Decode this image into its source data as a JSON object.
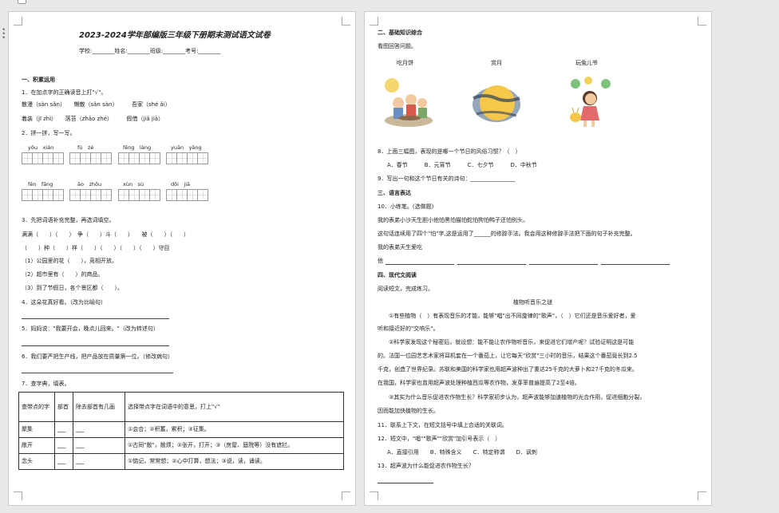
{
  "p1": {
    "title": "2023-2024学年部编版三年级下册期末测试语文试卷",
    "info": "学校:________姓名:________班级:________考号:________",
    "s1": "一、积累运用",
    "q1": "1．在加点字的正确读音上打\"√\"。",
    "q1a": "散漫（sàn sǎn）　　懒散（sǎn sàn）　　　吾家（shé ǎi）",
    "q1b": "着装（jī zhì）　　落苔（zhǎo zhé）　　　假借（jiǎ jià）",
    "q2": "2．拼一拼，写一写。",
    "py1": [
      "yōu　xián",
      "fù　zé",
      "fēng　làng",
      "yuān　yāng"
    ],
    "py2": [
      "fēn　fāng",
      "āo　zhōu",
      "xùn　sù",
      "dōi　jiā"
    ],
    "q3": "3．先把词语补充完整，再选词填空。",
    "q3a": "满满（　　）（　　）　争（　　）斗（　　）　　被（　　）（　　）",
    "q3b": "（　　）种（　　）样（　　）（　　）（　　）（　　）守目",
    "q3c": "（1）公园里的花（　　），竞相开放。",
    "q3d": "（2）超市里有（　　）的商品。",
    "q3e": "（3）到了节假日，各个景区都（　　）。",
    "q4": "4．这朵花真好看。（改为比喻句）",
    "q5": "5．妈妈说：\"我要开会，晚点儿回来。\"（改为转述句）",
    "q6": "6．我们要严把生产线，把产品放在质量第一位。（修改病句）",
    "q7": "7．查字典，填表。",
    "table": {
      "head": [
        "查带点的字",
        "部首",
        "除去部首有几画",
        "选择带点字在词语中的意思，打上\"√\""
      ],
      "rows": [
        [
          "聚集",
          "___",
          "___",
          "①会合；②积蓄，累积；③征集。"
        ],
        [
          "敞开",
          "___",
          "___",
          "①古同\"敞\"，敞烦；②张开，打开；③（房屋、庭院等）没有遮拦。"
        ],
        [
          "念头",
          "___",
          "___",
          "①惦记，常常想；②心中打算，想法；③说，读，诵读。"
        ]
      ]
    }
  },
  "p2": {
    "s2": "二、基础知识综合",
    "intro": "看图回答问题。",
    "cap": [
      "吃月饼",
      "赏月",
      "玩兔儿爷"
    ],
    "q8": "8．上面三幅图，表现的是哪一个节日的风俗习惯？（　）",
    "q8opts": "A．春节　　　B．元宵节　　　C．七夕节　　　D．中秋节",
    "q9": "9．写出一句和这个节日有关的诗句：________________",
    "s3": "三、语言表达",
    "q10": "10．小练笔。(选做题)",
    "q10a": "我的表弟小沙天生胆小他怕黑怕猫怕蛇怕狗怕鸭子还怕别头。",
    "q10b": "这句话连续用了四个\"怕\"字,这是运用了______的修辞手法。我会用这种修辞手法把下面的句子补充完整。",
    "q10c": "我的表弟天生爱吃",
    "q10d": "他",
    "s4": "四、现代文阅读",
    "intro2": "阅读短文，完成练习。",
    "ptitle": "植物听音乐之谜",
    "para1a": "①有些植物（　）有表现音乐的才能，能够\"唱\"出不同旋律的\"歌声\"，（　）它们还是音乐爱好者，爱",
    "para1b": "听和接近好的\"交响乐\"。",
    "para2a": "②科学家发现这个秘密后，就设想：能不能让农作物听音乐，来促进它们增产呢？试验证明这是可能",
    "para2b": "的。法国一位园艺艺术家将耳机套在一个番茄上，让它每天\"欣赏\"三小时的音乐，结果这个番茄竟长到2.5",
    "para2c": "千克，创造了世界纪录。苏联和美国的科学家也用超声波种出了重达25千克的大萝卜和27千克的冬瓜来。",
    "para2d": "在我国，科学家也曾用超声波处理种植西瓜等农作物，发芽率普遍提高了2至4倍。",
    "para3a": "③其实为什么音乐促进农作物生长？科学家初步认为，超声波能够加速植物的光合作用，促进细胞分裂，",
    "para3b": "因而能加快植物的生长。",
    "q11": "11．联系上下文，在短文括号中填上合适的关联词。",
    "q12": "12．短文中，\"唱\"\"歌声\"\"欣赏\"加引号表示（　）",
    "q12opts": "A．直接引用　　B．特殊含义　　C．特定称谓　　D．讽刺",
    "q13": "13．超声波为什么能促进农作物生长？"
  }
}
